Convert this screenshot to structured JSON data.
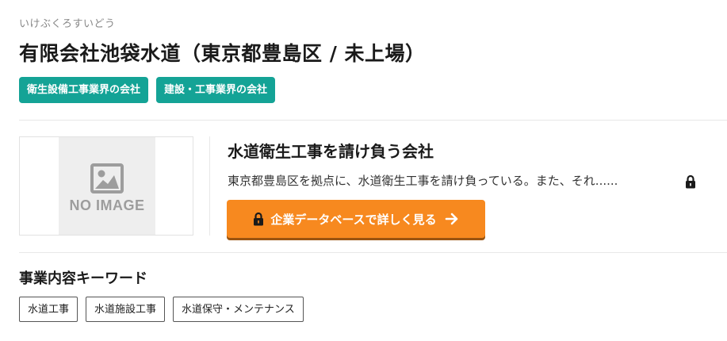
{
  "company": {
    "kana": "いけぶくろすいどう",
    "name": "有限会社池袋水道（東京都豊島区 / 未上場）"
  },
  "industry_tags": [
    "衛生設備工事業界の会社",
    "建設・工事業界の会社"
  ],
  "thumbnail": {
    "text": "NO IMAGE",
    "icon": "image-placeholder-icon"
  },
  "overview": {
    "headline": "水道衛生工事を請け負う会社",
    "summary": "東京都豊島区を拠点に、水道衛生工事を請け負っている。また、それ......",
    "summary_icon": "lock-icon",
    "cta_label": "企業データベースで詳しく見る",
    "cta_icons": [
      "lock-icon",
      "arrow-right-icon"
    ]
  },
  "keywords": {
    "heading": "事業内容キーワード",
    "items": [
      "水道工事",
      "水道施設工事",
      "水道保守・メンテナンス"
    ]
  },
  "colors": {
    "tag_background": "#14a396",
    "cta_background": "#f7891f",
    "cta_shadow": "#9a5410"
  }
}
